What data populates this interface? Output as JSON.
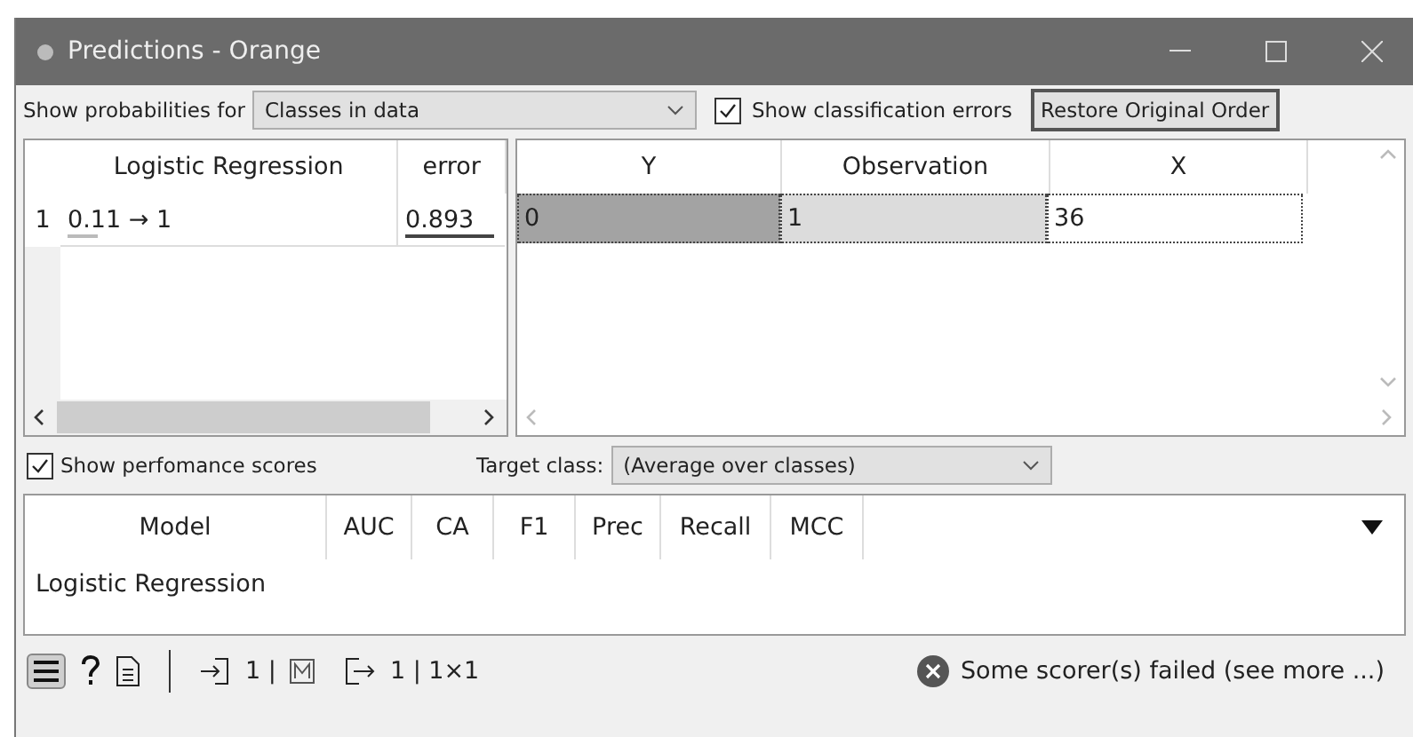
{
  "window": {
    "title": "Predictions - Orange"
  },
  "toolbar": {
    "probabilities_label": "Show probabilities for",
    "probabilities_value": "Classes in data",
    "errors_checkbox": {
      "label": "Show classification errors",
      "checked": true
    },
    "restore_button": "Restore Original Order"
  },
  "predictions": {
    "columns": [
      "Logistic Regression",
      "error"
    ],
    "rows": [
      {
        "index": "1",
        "prediction": "0.11 → 1",
        "prediction_bar": {
          "level": 0.11
        },
        "error": "0.893"
      }
    ]
  },
  "data_table": {
    "columns": [
      "Y",
      "Observation",
      "X"
    ],
    "rows": [
      {
        "cells": [
          {
            "text": "0",
            "kind": "target"
          },
          {
            "text": "1",
            "kind": "meta"
          },
          {
            "text": "36",
            "kind": "feature"
          }
        ]
      }
    ]
  },
  "scores": {
    "checkbox": {
      "label": "Show perfomance scores",
      "checked": true
    },
    "target_label": "Target class:",
    "target_value": "(Average over classes)",
    "columns": [
      "Model",
      "AUC",
      "CA",
      "F1",
      "Prec",
      "Recall",
      "MCC"
    ],
    "rows": [
      "Logistic Regression"
    ]
  },
  "status_bar": {
    "input": "1 |",
    "output": "1 | 1×1",
    "message": "Some scorer(s) failed (see more ...)"
  }
}
